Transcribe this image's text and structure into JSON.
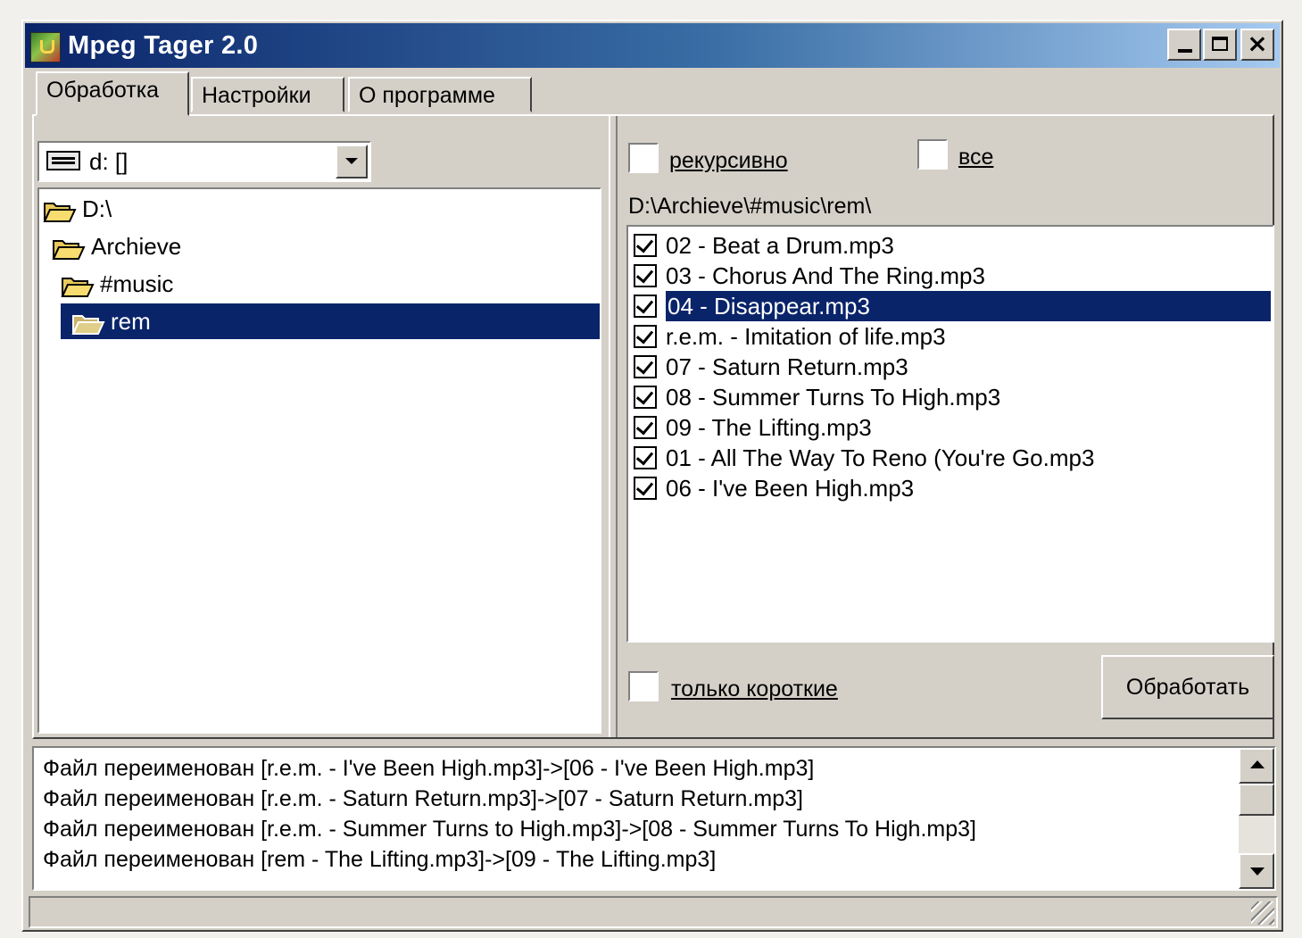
{
  "window": {
    "title": "Mpeg Tager 2.0"
  },
  "tabs": [
    {
      "label": "Обработка",
      "active": true
    },
    {
      "label": "Настройки",
      "active": false
    },
    {
      "label": "О программе",
      "active": false
    }
  ],
  "drive": {
    "selected": "d: []"
  },
  "tree": [
    {
      "label": "D:\\",
      "level": 0,
      "selected": false
    },
    {
      "label": "Archieve",
      "level": 1,
      "selected": false
    },
    {
      "label": "#music",
      "level": 2,
      "selected": false
    },
    {
      "label": "rem",
      "level": 3,
      "selected": true
    }
  ],
  "options": {
    "recursive_label": "рекурсивно",
    "recursive_checked": false,
    "all_label": "все",
    "all_checked": false,
    "short_only_label": "только короткие",
    "short_only_checked": false
  },
  "current_path": "D:\\Archieve\\#music\\rem\\",
  "files": [
    {
      "name": "02 - Beat a Drum.mp3",
      "checked": true,
      "selected": false
    },
    {
      "name": "03 - Chorus And The Ring.mp3",
      "checked": true,
      "selected": false
    },
    {
      "name": "04 - Disappear.mp3",
      "checked": true,
      "selected": true
    },
    {
      "name": "r.e.m. - Imitation of life.mp3",
      "checked": true,
      "selected": false
    },
    {
      "name": "07 - Saturn Return.mp3",
      "checked": true,
      "selected": false
    },
    {
      "name": "08 - Summer Turns To High.mp3",
      "checked": true,
      "selected": false
    },
    {
      "name": "09 - The Lifting.mp3",
      "checked": true,
      "selected": false
    },
    {
      "name": "01 - All The Way To Reno (You're Go.mp3",
      "checked": true,
      "selected": false
    },
    {
      "name": "06 - I've Been High.mp3",
      "checked": true,
      "selected": false
    }
  ],
  "process_button": "Обработать",
  "log": [
    "Файл переименован [r.e.m. - I've Been High.mp3]->[06 - I've Been High.mp3]",
    "Файл переименован [r.e.m. - Saturn Return.mp3]->[07 - Saturn Return.mp3]",
    "Файл переименован [r.e.m. - Summer Turns to High.mp3]->[08 - Summer Turns To High.mp3]",
    "Файл переименован [rem - The Lifting.mp3]->[09 - The Lifting.mp3]"
  ],
  "colors": {
    "face": "#d4d0c8",
    "selection": "#0a246a",
    "title_start": "#0a246a",
    "title_end": "#a6caf0"
  }
}
